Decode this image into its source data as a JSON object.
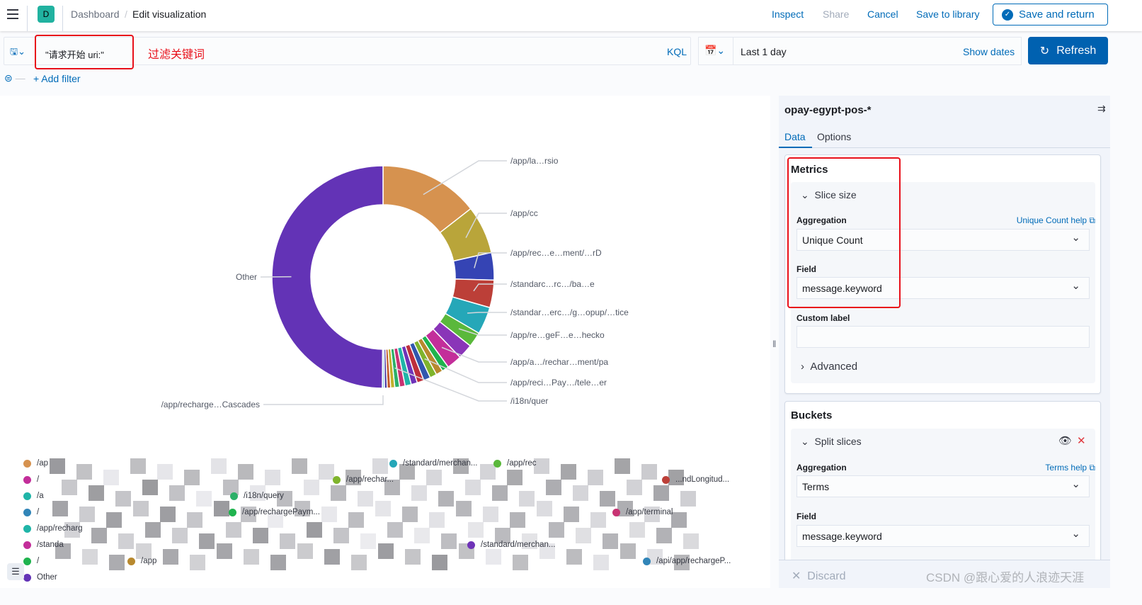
{
  "header": {
    "badge": "D",
    "breadcrumb": [
      "Dashboard",
      "Edit visualization"
    ],
    "actions": {
      "inspect": "Inspect",
      "share": "Share",
      "cancel": "Cancel",
      "save_library": "Save to library",
      "save_return": "Save and return"
    }
  },
  "query": {
    "value": "\"请求开始 uri:\"",
    "annotation": "过滤关键词",
    "language": "KQL"
  },
  "date": {
    "range": "Last 1 day",
    "show_dates": "Show dates",
    "refresh": "Refresh"
  },
  "filters": {
    "add": "+ Add filter"
  },
  "panel": {
    "index": "opay-egypt-pos-*",
    "tabs": [
      "Data",
      "Options"
    ],
    "metrics": {
      "title": "Metrics",
      "item": "Slice size",
      "agg_label": "Aggregation",
      "agg_help": "Unique Count help",
      "agg_value": "Unique Count",
      "field_label": "Field",
      "field_value": "message.keyword",
      "custom_label": "Custom label",
      "custom_value": "",
      "advanced": "Advanced"
    },
    "buckets": {
      "title": "Buckets",
      "item": "Split slices",
      "agg_label": "Aggregation",
      "agg_help": "Terms help",
      "agg_value": "Terms",
      "field_label": "Field",
      "field_value": "message.keyword"
    },
    "discard": "Discard"
  },
  "watermark": "CSDN @跟心爱的人浪迹天涯",
  "chart_data": {
    "type": "pie",
    "donut": true,
    "slices": [
      {
        "label": "/app/la…rsio",
        "value": 14.5,
        "color": "#d6924f"
      },
      {
        "label": "/app/cc",
        "value": 7,
        "color": "#b9a53a"
      },
      {
        "label": "/app/rec…e…ment/…rD",
        "value": 4,
        "color": "#3544b4"
      },
      {
        "label": "/standarc…rc…/ba…e",
        "value": 4,
        "color": "#bc3f38"
      },
      {
        "label": "/standar…erc…/g…opup/…tice",
        "value": 4,
        "color": "#25a7b8"
      },
      {
        "label": "/app/re…geF…e…hecko",
        "value": 2.2,
        "color": "#5ab83b"
      },
      {
        "label": "",
        "value": 2.2,
        "color": "#8a35b8"
      },
      {
        "label": "/app/a…/rechar…ment/pa",
        "value": 2.2,
        "color": "#c32e9a"
      },
      {
        "label": "",
        "value": 1,
        "color": "#1fb34e"
      },
      {
        "label": "",
        "value": 1,
        "color": "#b8892e"
      },
      {
        "label": "/app/reci…Pay…/tele…er",
        "value": 1,
        "color": "#7fb42c"
      },
      {
        "label": "",
        "value": 1,
        "color": "#3157ae"
      },
      {
        "label": "",
        "value": 1,
        "color": "#bd2f3c"
      },
      {
        "label": "",
        "value": 0.9,
        "color": "#6f33b8"
      },
      {
        "label": "",
        "value": 0.9,
        "color": "#20b5a8"
      },
      {
        "label": "",
        "value": 0.8,
        "color": "#c83373"
      },
      {
        "label": "/i18n/quer",
        "value": 0.7,
        "color": "#2cb068"
      },
      {
        "label": "",
        "value": 0.6,
        "color": "#c0b02a"
      },
      {
        "label": "",
        "value": 0.5,
        "color": "#c25a2a"
      },
      {
        "label": "",
        "value": 0.4,
        "color": "#4a3aa6"
      },
      {
        "label": "/app/recharge…Cascades",
        "value": 0.3,
        "color": "#8fd0e0"
      },
      {
        "label": "Other",
        "value": 50,
        "color": "#6333b6"
      }
    ],
    "legend": [
      {
        "label": "/ap",
        "color": "#d6924f"
      },
      {
        "label": "/standard/merchan...",
        "color": "#25a7b8"
      },
      {
        "label": "/app/rec",
        "color": "#5ab83b"
      },
      {
        "label": "/",
        "color": "#c32e9a"
      },
      {
        "label": "/app/rechar...",
        "color": "#7fb42c"
      },
      {
        "label": "...ndLongitud...",
        "color": "#bc3f38"
      },
      {
        "label": "/a",
        "color": "#20b5a8"
      },
      {
        "label": "/i18n/query",
        "color": "#2cb068"
      },
      {
        "label": "/",
        "color": "#3185b8"
      },
      {
        "label": "/app/rechargePaym...",
        "color": "#1fb34e"
      },
      {
        "label": "/app/terminal",
        "color": "#c83373"
      },
      {
        "label": "/app/recharg",
        "color": "#20b5a8"
      },
      {
        "label": "/standa",
        "color": "#c32e9a"
      },
      {
        "label": "/standard/merchan...",
        "color": "#6f33b8"
      },
      {
        "label": "/",
        "color": "#1fb34e"
      },
      {
        "label": "/app",
        "color": "#b8892e"
      },
      {
        "label": "/api/app/rechargeP...",
        "color": "#3185b8"
      },
      {
        "label": "Other",
        "color": "#6333b6"
      }
    ],
    "legend_position": "bottom"
  }
}
